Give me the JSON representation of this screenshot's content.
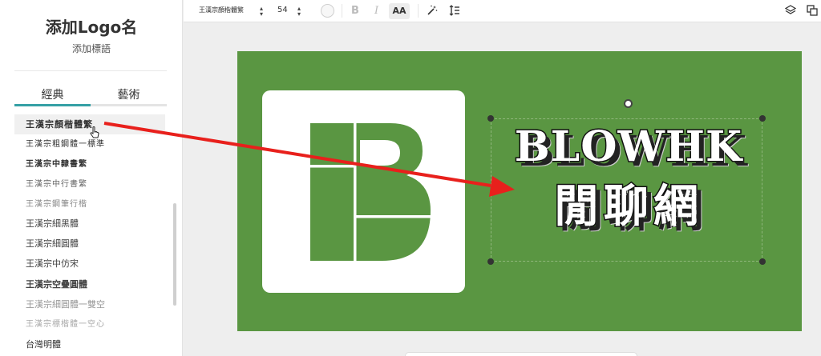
{
  "sidebar": {
    "logo_name": "添加Logo名",
    "slogan": "添加標語",
    "tabs": [
      {
        "label": "經典"
      },
      {
        "label": "藝術"
      }
    ],
    "fonts": [
      {
        "label": "王漢宗顏楷體繁"
      },
      {
        "label": "王漢宗粗鋼體一標準"
      },
      {
        "label": "王漢宗中隸書繁"
      },
      {
        "label": "王漢宗中行書繁"
      },
      {
        "label": "王漢宗鋼筆行楷"
      },
      {
        "label": "王漢宗細黑體"
      },
      {
        "label": "王漢宗細圓體"
      },
      {
        "label": "王漢宗中仿宋"
      },
      {
        "label": "王漢宗空疊圓體"
      },
      {
        "label": "王漢宗細圓體一雙空"
      },
      {
        "label": "王漢宗標楷體一空心"
      },
      {
        "label": "台灣明體"
      }
    ]
  },
  "toolbar": {
    "font": "王漢宗顏楷體繁",
    "size": "54",
    "bold": "B",
    "italic": "I",
    "caps": "AA",
    "color_swatch": "#f7f7f7"
  },
  "canvas": {
    "background": "#5a9642",
    "title": "BLOWHK",
    "subtitle": "閒聊網"
  },
  "colors": {
    "accent": "#35a0a5",
    "arrow": "#e8201c"
  }
}
